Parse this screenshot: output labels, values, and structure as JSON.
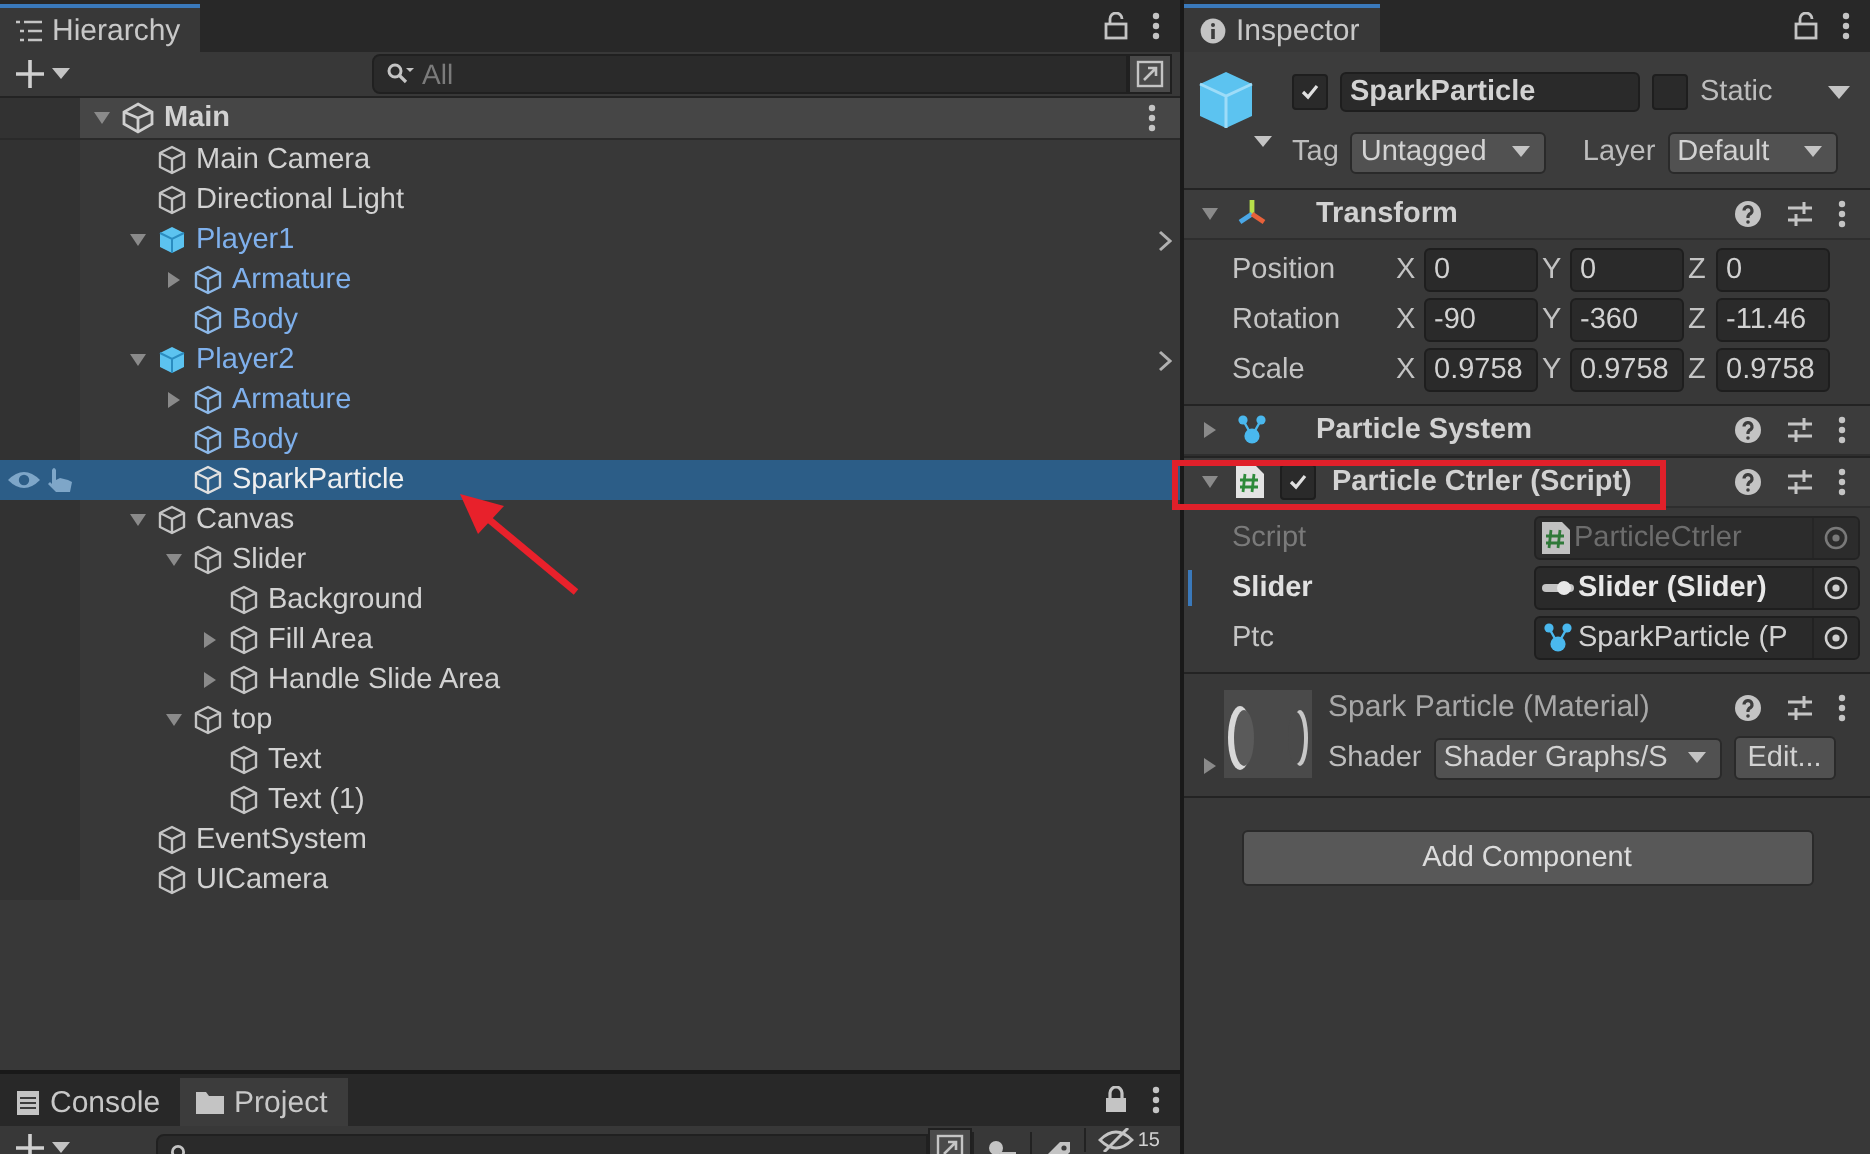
{
  "hierarchy": {
    "title": "Hierarchy",
    "search": {
      "placeholder": "All"
    },
    "scene": {
      "name": "Main",
      "expanded": true
    },
    "items": [
      {
        "name": "Main Camera",
        "kind": "object",
        "selected": false
      },
      {
        "name": "Directional Light",
        "kind": "object",
        "selected": false
      },
      {
        "name": "Player1",
        "kind": "prefab_root",
        "selected": false,
        "expanded": true,
        "children": [
          {
            "name": "Armature",
            "kind": "prefab_child",
            "selected": false,
            "expanded": false
          },
          {
            "name": "Body",
            "kind": "prefab_child",
            "selected": false
          }
        ]
      },
      {
        "name": "Player2",
        "kind": "prefab_root",
        "selected": false,
        "expanded": true,
        "children": [
          {
            "name": "Armature",
            "kind": "prefab_child",
            "selected": false,
            "expanded": false
          },
          {
            "name": "Body",
            "kind": "prefab_child",
            "selected": false
          },
          {
            "name": "SparkParticle",
            "kind": "object",
            "selected": true
          }
        ]
      },
      {
        "name": "Canvas",
        "kind": "object",
        "selected": false,
        "expanded": true,
        "children": [
          {
            "name": "Slider",
            "kind": "object",
            "selected": false,
            "expanded": true,
            "children": [
              {
                "name": "Background",
                "kind": "object",
                "selected": false
              },
              {
                "name": "Fill Area",
                "kind": "object",
                "selected": false,
                "expanded": false
              },
              {
                "name": "Handle Slide Area",
                "kind": "object",
                "selected": false,
                "expanded": false
              }
            ]
          },
          {
            "name": "top",
            "kind": "object",
            "selected": false,
            "expanded": true,
            "children": [
              {
                "name": "Text",
                "kind": "object",
                "selected": false
              },
              {
                "name": "Text (1)",
                "kind": "object",
                "selected": false
              }
            ]
          }
        ]
      },
      {
        "name": "EventSystem",
        "kind": "object",
        "selected": false
      },
      {
        "name": "UICamera",
        "kind": "object",
        "selected": false
      }
    ]
  },
  "inspector": {
    "title": "Inspector",
    "object": {
      "active": true,
      "name": "SparkParticle",
      "static_label": "Static",
      "static": false,
      "tag_label": "Tag",
      "tag": "Untagged",
      "layer_label": "Layer",
      "layer": "Default"
    },
    "components": [
      {
        "kind": "transform",
        "name": "Transform",
        "expanded": true,
        "rows": [
          {
            "label": "Position",
            "values": [
              {
                "axis": "X",
                "value": "0"
              },
              {
                "axis": "Y",
                "value": "0"
              },
              {
                "axis": "Z",
                "value": "0"
              }
            ]
          },
          {
            "label": "Rotation",
            "values": [
              {
                "axis": "X",
                "value": "-90"
              },
              {
                "axis": "Y",
                "value": "-360"
              },
              {
                "axis": "Z",
                "value": "-11.46"
              }
            ]
          },
          {
            "label": "Scale",
            "values": [
              {
                "axis": "X",
                "value": "0.9758"
              },
              {
                "axis": "Y",
                "value": "0.9758"
              },
              {
                "axis": "Z",
                "value": "0.9758"
              }
            ]
          }
        ]
      },
      {
        "kind": "particles",
        "name": "Particle System",
        "expanded": false
      },
      {
        "kind": "script",
        "name": "Particle Ctrler (Script)",
        "enabled": true,
        "expanded": true,
        "fields": [
          {
            "label": "Script",
            "value": "ParticleCtrler",
            "kind": "script",
            "disabled": true,
            "selected": false
          },
          {
            "label": "Slider",
            "value": "Slider (Slider)",
            "kind": "slider",
            "disabled": false,
            "selected": true
          },
          {
            "label": "Ptc",
            "value": "SparkParticle (P",
            "kind": "particles",
            "disabled": false,
            "selected": false
          }
        ]
      }
    ],
    "material": {
      "name": "Spark Particle (Material)",
      "shader_label": "Shader",
      "shader": "Shader Graphs/S",
      "edit": "Edit..."
    },
    "add_button": "Add Component"
  },
  "bottom": {
    "tabs": [
      {
        "label": "Console",
        "kind": "console",
        "selected": false
      },
      {
        "label": "Project",
        "kind": "folder",
        "selected": true
      }
    ],
    "hidden_count": "15"
  }
}
